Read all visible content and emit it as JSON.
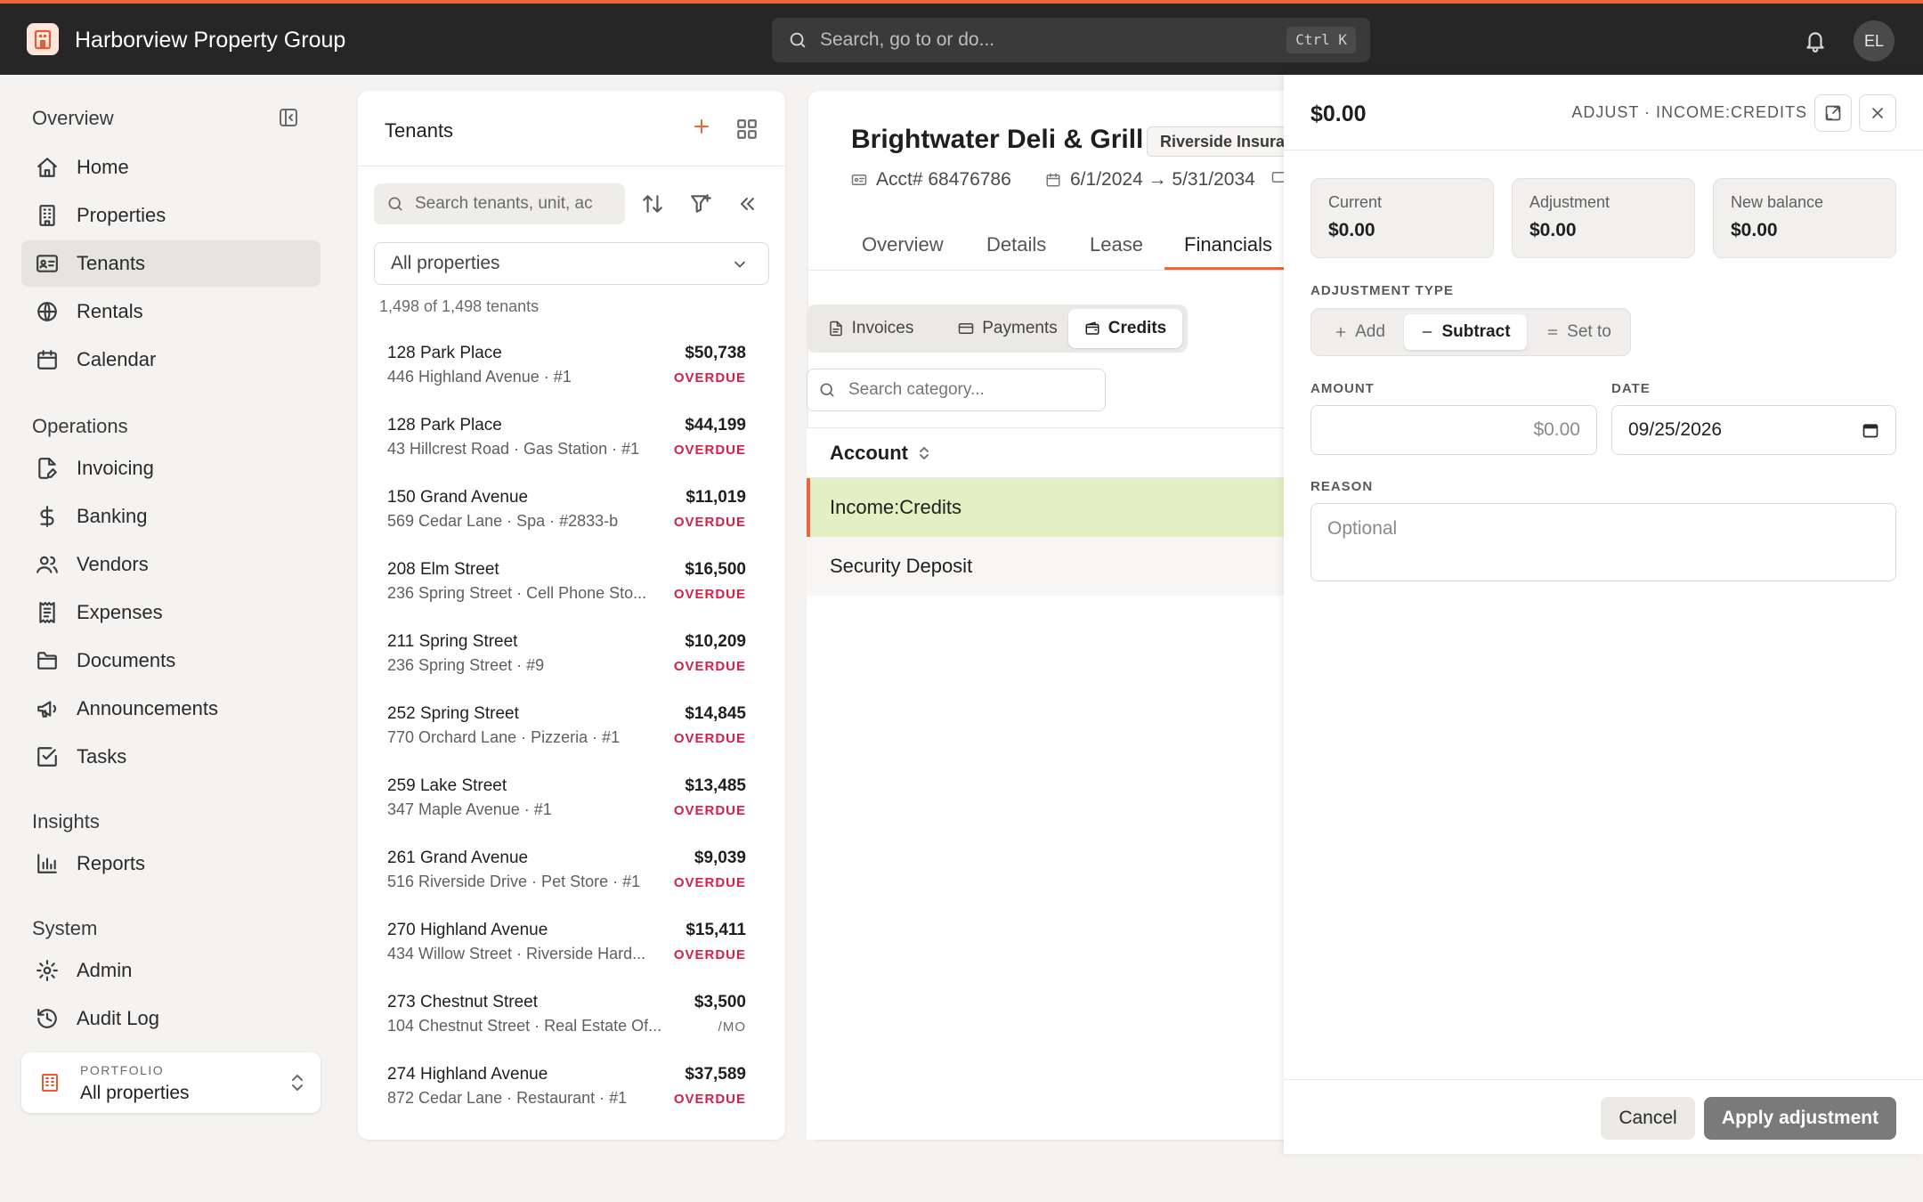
{
  "app": {
    "title": "Harborview Property Group",
    "search_placeholder": "Search, go to or do...",
    "shortcut": "Ctrl K",
    "user_initials": "EL",
    "accent_color": "#f0643c"
  },
  "sidebar": {
    "sections": [
      {
        "title": "Overview",
        "items": [
          {
            "label": "Home",
            "icon": "home-icon"
          },
          {
            "label": "Properties",
            "icon": "building-icon"
          },
          {
            "label": "Tenants",
            "icon": "id-card-icon",
            "active": true
          },
          {
            "label": "Rentals",
            "icon": "globe-icon"
          },
          {
            "label": "Calendar",
            "icon": "calendar-icon"
          }
        ]
      },
      {
        "title": "Operations",
        "items": [
          {
            "label": "Invoicing",
            "icon": "file-pen-icon"
          },
          {
            "label": "Banking",
            "icon": "dollar-icon"
          },
          {
            "label": "Vendors",
            "icon": "users-icon"
          },
          {
            "label": "Expenses",
            "icon": "receipt-icon"
          },
          {
            "label": "Documents",
            "icon": "folder-icon"
          },
          {
            "label": "Announcements",
            "icon": "megaphone-icon"
          },
          {
            "label": "Tasks",
            "icon": "checkbox-icon"
          }
        ]
      },
      {
        "title": "Insights",
        "items": [
          {
            "label": "Reports",
            "icon": "bar-chart-icon"
          }
        ]
      },
      {
        "title": "System",
        "items": [
          {
            "label": "Admin",
            "icon": "gear-icon"
          },
          {
            "label": "Audit Log",
            "icon": "history-icon"
          }
        ]
      }
    ],
    "portfolio": {
      "label": "PORTFOLIO",
      "value": "All properties"
    }
  },
  "tenants": {
    "title": "Tenants",
    "search_placeholder": "Search tenants, unit, ac",
    "property_filter": "All properties",
    "count_text": "1,498 of 1,498 tenants",
    "rows": [
      {
        "name": "128 Park Place",
        "address": "446 Highland Avenue · #1",
        "amount": "$50,738",
        "status": "OVERDUE"
      },
      {
        "name": "128 Park Place",
        "address": "43 Hillcrest Road · Gas Station · #1",
        "amount": "$44,199",
        "status": "OVERDUE"
      },
      {
        "name": "150 Grand Avenue",
        "address": "569 Cedar Lane · Spa · #2833-b",
        "amount": "$11,019",
        "status": "OVERDUE"
      },
      {
        "name": "208 Elm Street",
        "address": "236 Spring Street · Cell Phone Sto...",
        "amount": "$16,500",
        "status": "OVERDUE"
      },
      {
        "name": "211 Spring Street",
        "address": "236 Spring Street · #9",
        "amount": "$10,209",
        "status": "OVERDUE"
      },
      {
        "name": "252 Spring Street",
        "address": "770 Orchard Lane · Pizzeria · #1",
        "amount": "$14,845",
        "status": "OVERDUE"
      },
      {
        "name": "259 Lake Street",
        "address": "347 Maple Avenue · #1",
        "amount": "$13,485",
        "status": "OVERDUE"
      },
      {
        "name": "261 Grand Avenue",
        "address": "516 Riverside Drive · Pet Store · #1",
        "amount": "$9,039",
        "status": "OVERDUE"
      },
      {
        "name": "270 Highland Avenue",
        "address": "434 Willow Street · Riverside Hard...",
        "amount": "$15,411",
        "status": "OVERDUE"
      },
      {
        "name": "273 Chestnut Street",
        "address": "104 Chestnut Street · Real Estate Of...",
        "amount": "$3,500",
        "status": "/MO"
      },
      {
        "name": "274 Highland Avenue",
        "address": "872 Cedar Lane · Restaurant · #1",
        "amount": "$37,589",
        "status": "OVERDUE"
      }
    ],
    "status_colors": {
      "overdue": "#d4204b",
      "monthly": "#6b6b6b"
    }
  },
  "detail": {
    "title": "Brightwater Deli & Grill",
    "badge": "Riverside Insura",
    "account": "Acct# 68476786",
    "lease_range": "6/1/2024 → 5/31/2034",
    "tabs": [
      "Overview",
      "Details",
      "Lease",
      "Financials"
    ],
    "active_tab": "Financials",
    "sub_tabs": [
      "Invoices",
      "Payments",
      "Credits"
    ],
    "active_sub_tab": "Credits",
    "category_search_placeholder": "Search category...",
    "account_column": "Account",
    "accounts": [
      "Income:Credits",
      "Security Deposit"
    ],
    "selected_account": "Income:Credits"
  },
  "drawer": {
    "amount": "$0.00",
    "tag": "ADJUST · INCOME:CREDITS",
    "stats": [
      {
        "label": "Current",
        "value": "$0.00"
      },
      {
        "label": "Adjustment",
        "value": "$0.00"
      },
      {
        "label": "New balance",
        "value": "$0.00"
      }
    ],
    "adjustment_type_label": "ADJUSTMENT TYPE",
    "adjustment_types": [
      "Add",
      "Subtract",
      "Set to"
    ],
    "active_adjustment_type": "Subtract",
    "amount_label": "AMOUNT",
    "amount_placeholder": "$0.00",
    "date_label": "DATE",
    "date_value": "09/25/2026",
    "reason_label": "REASON",
    "reason_placeholder": "Optional",
    "cancel_label": "Cancel",
    "apply_label": "Apply adjustment"
  }
}
